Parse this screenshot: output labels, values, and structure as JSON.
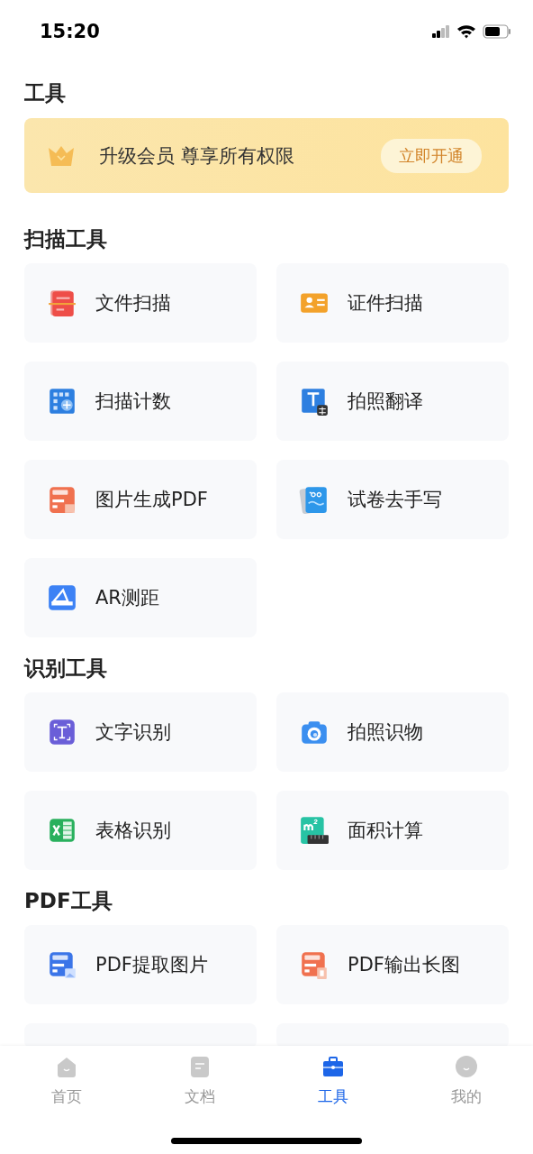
{
  "status_bar": {
    "time": "15:20"
  },
  "page_title": "工具",
  "banner": {
    "text": "升级会员 尊享所有权限",
    "button": "立即开通"
  },
  "sections": [
    {
      "title": "扫描工具",
      "items": [
        {
          "label": "文件扫描"
        },
        {
          "label": "证件扫描"
        },
        {
          "label": "扫描计数"
        },
        {
          "label": "拍照翻译"
        },
        {
          "label": "图片生成PDF"
        },
        {
          "label": "试卷去手写"
        },
        {
          "label": "AR测距"
        }
      ]
    },
    {
      "title": "识别工具",
      "items": [
        {
          "label": "文字识别"
        },
        {
          "label": "拍照识物"
        },
        {
          "label": "表格识别"
        },
        {
          "label": "面积计算"
        }
      ]
    },
    {
      "title": "PDF工具",
      "items": [
        {
          "label": "PDF提取图片"
        },
        {
          "label": "PDF输出长图"
        },
        {
          "kind": "cut_off"
        },
        {
          "kind": "cut_off"
        }
      ]
    }
  ],
  "tab_bar": [
    {
      "label": "首页",
      "selected": false
    },
    {
      "label": "文档",
      "selected": false
    },
    {
      "label": "工具",
      "selected": true
    },
    {
      "label": "我的",
      "selected": false
    }
  ]
}
